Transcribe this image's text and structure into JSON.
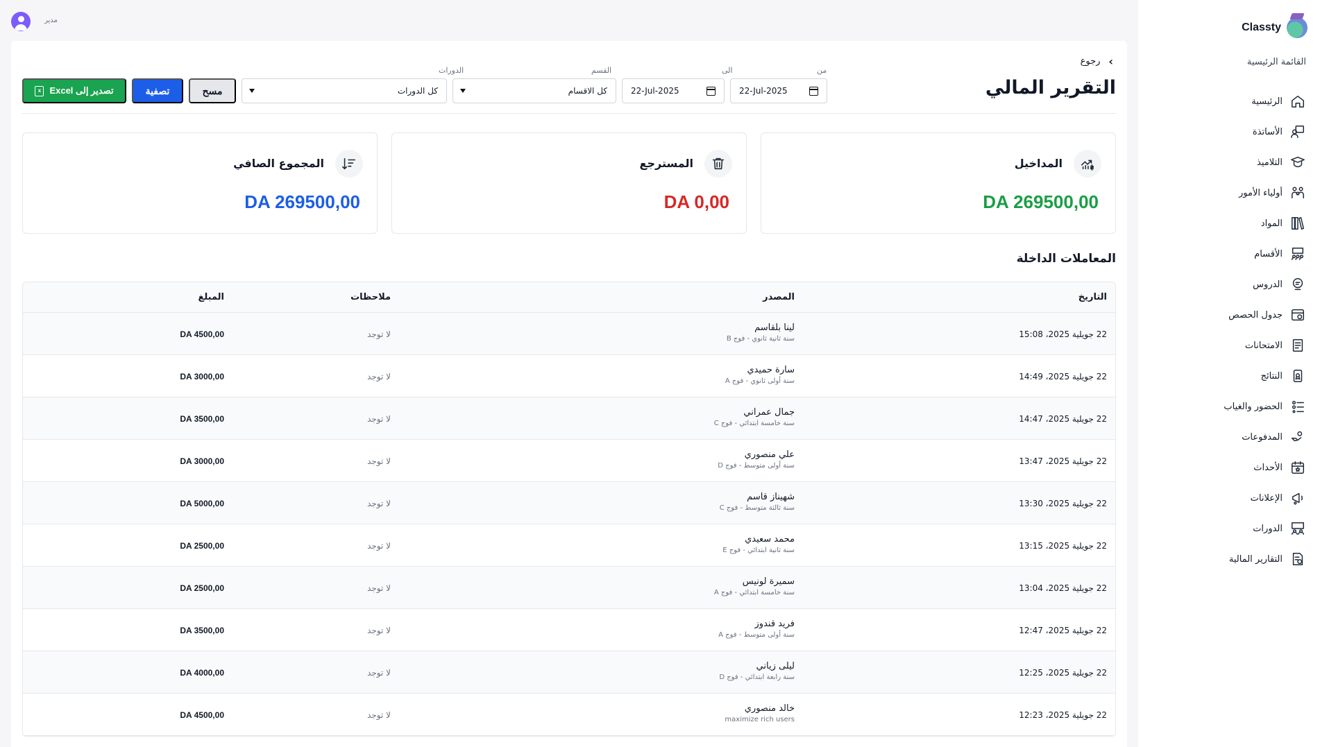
{
  "header": {
    "role": "مدير"
  },
  "sidebar": {
    "brand": "Classty",
    "menu_title": "القائمة الرئيسية",
    "items": [
      {
        "label": "الرئيسية",
        "icon": "home-icon"
      },
      {
        "label": "الأساتذة",
        "icon": "teacher-icon"
      },
      {
        "label": "التلاميذ",
        "icon": "graduation-cap-icon"
      },
      {
        "label": "أولياء الأمور",
        "icon": "family-icon"
      },
      {
        "label": "المواد",
        "icon": "books-icon"
      },
      {
        "label": "الأقسام",
        "icon": "classroom-icon"
      },
      {
        "label": "الدروس",
        "icon": "lesson-icon"
      },
      {
        "label": "جدول الحصص",
        "icon": "schedule-icon"
      },
      {
        "label": "الامتحانات",
        "icon": "exam-icon"
      },
      {
        "label": "النتائج",
        "icon": "results-icon"
      },
      {
        "label": "الحضور والغياب",
        "icon": "attendance-icon"
      },
      {
        "label": "المدفوعات",
        "icon": "payments-icon"
      },
      {
        "label": "الأحداث",
        "icon": "calendar-star-icon"
      },
      {
        "label": "الإعلانات",
        "icon": "megaphone-icon"
      },
      {
        "label": "الدورات",
        "icon": "courses-icon"
      },
      {
        "label": "التقارير المالية",
        "icon": "financial-report-icon"
      }
    ]
  },
  "page": {
    "back_label": "رجوع",
    "title": "التقرير المالي"
  },
  "filters": {
    "from_label": "من",
    "from_value": "22-Jul-2025",
    "to_label": "الى",
    "to_value": "22-Jul-2025",
    "section_label": "القسم",
    "section_value": "كل الاقسام",
    "courses_label": "الدورات",
    "courses_value": "كل الدورات",
    "clear_label": "مسح",
    "filter_label": "تصفية",
    "export_label": "تصدير إلى Excel"
  },
  "stats": {
    "income": {
      "label": "المداخيل",
      "value": "DA 269500,00",
      "color": "#1a9e45"
    },
    "refund": {
      "label": "المسترجع",
      "value": "DA 0,00",
      "color": "#d62828"
    },
    "net": {
      "label": "المجموع الصافي",
      "value": "DA 269500,00",
      "color": "#1c5ee8"
    }
  },
  "table": {
    "title": "المعاملات الداخلة",
    "columns": {
      "date": "التاريخ",
      "source": "المصدر",
      "notes": "ملاحظات",
      "amount": "المبلغ"
    },
    "rows": [
      {
        "date": "22 جويلية 2025، 15:08",
        "name": "لينا بلقاسم",
        "sub": "سنة ثانية ثانوي - فوج B",
        "notes": "لا توجد",
        "amount": "DA 4500,00"
      },
      {
        "date": "22 جويلية 2025، 14:49",
        "name": "سارة حميدي",
        "sub": "سنة أولى ثانوي - فوج A",
        "notes": "لا توجد",
        "amount": "DA 3000,00"
      },
      {
        "date": "22 جويلية 2025، 14:47",
        "name": "جمال عمراني",
        "sub": "سنة خامسة ابتدائي - فوج C",
        "notes": "لا توجد",
        "amount": "DA 3500,00"
      },
      {
        "date": "22 جويلية 2025، 13:47",
        "name": "علي منصوري",
        "sub": "سنة أولى متوسط - فوج D",
        "notes": "لا توجد",
        "amount": "DA 3000,00"
      },
      {
        "date": "22 جويلية 2025، 13:30",
        "name": "شهيناز قاسم",
        "sub": "سنة ثالثة متوسط - فوج C",
        "notes": "لا توجد",
        "amount": "DA 5000,00"
      },
      {
        "date": "22 جويلية 2025، 13:15",
        "name": "محمد سعيدي",
        "sub": "سنة ثانية ابتدائي - فوج E",
        "notes": "لا توجد",
        "amount": "DA 2500,00"
      },
      {
        "date": "22 جويلية 2025، 13:04",
        "name": "سميرة لونيس",
        "sub": "سنة خامسة ابتدائي - فوج A",
        "notes": "لا توجد",
        "amount": "DA 2500,00"
      },
      {
        "date": "22 جويلية 2025، 12:47",
        "name": "فريد قندوز",
        "sub": "سنة أولى متوسط - فوج A",
        "notes": "لا توجد",
        "amount": "DA 3500,00"
      },
      {
        "date": "22 جويلية 2025، 12:25",
        "name": "ليلى زياني",
        "sub": "سنة رابعة ابتدائي - فوج D",
        "notes": "لا توجد",
        "amount": "DA 4000,00"
      },
      {
        "date": "22 جويلية 2025، 12:23",
        "name": "خالد منصوري",
        "sub": "maximize rich users",
        "notes": "لا توجد",
        "amount": "DA 4500,00"
      }
    ]
  }
}
